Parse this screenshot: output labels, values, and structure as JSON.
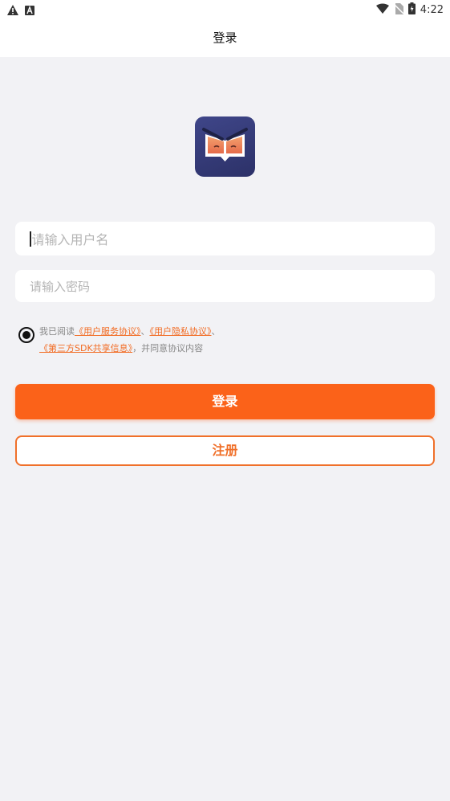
{
  "status_bar": {
    "time": "4:22",
    "icons": [
      "warning-icon",
      "a-icon",
      "wifi-icon",
      "no-sim-icon",
      "battery-icon"
    ]
  },
  "header": {
    "title": "登录"
  },
  "form": {
    "username_placeholder": "请输入用户名",
    "password_placeholder": "请输入密码"
  },
  "agreement": {
    "prefix": "我已阅读",
    "link_service": "《用户服务协议》",
    "sep1": "、",
    "link_privacy": "《用户隐私协议》",
    "sep2": "、",
    "link_sdk": "《第三方SDK共享信息》",
    "suffix": "，并同意协议内容",
    "checked": true
  },
  "buttons": {
    "login": "登录",
    "register": "注册"
  },
  "colors": {
    "accent": "#fb6219",
    "background": "#f2f2f5",
    "logo_bg": "#3f4689"
  }
}
